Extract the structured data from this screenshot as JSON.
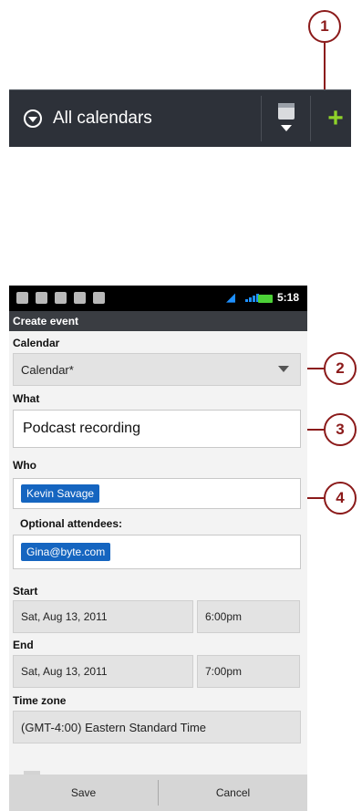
{
  "callouts": [
    "1",
    "2",
    "3",
    "4"
  ],
  "calendar_bar": {
    "selector_label": "All calendars",
    "icons": [
      "chevron-down-icon",
      "calendar-view-icon",
      "add-icon"
    ],
    "add_symbol": "+"
  },
  "status_bar": {
    "time": "5:18"
  },
  "screen_title": "Create event",
  "form": {
    "calendar_label": "Calendar",
    "calendar_value": "Calendar*",
    "what_label": "What",
    "what_value": "Podcast recording",
    "who_label": "Who",
    "who_chip": "Kevin Savage",
    "optional_label": "Optional attendees:",
    "optional_chip": "Gina@byte.com",
    "start_label": "Start",
    "start_date": "Sat, Aug 13, 2011",
    "start_time": "6:00pm",
    "end_label": "End",
    "end_date": "Sat, Aug 13, 2011",
    "end_time": "7:00pm",
    "timezone_label": "Time zone",
    "timezone_value": "(GMT-4:00) Eastern Standard Time"
  },
  "actions": {
    "save": "Save",
    "cancel": "Cancel"
  },
  "colors": {
    "accent_green": "#8fd32a",
    "callout": "#8b1a1a",
    "chip_blue": "#1565c0"
  }
}
